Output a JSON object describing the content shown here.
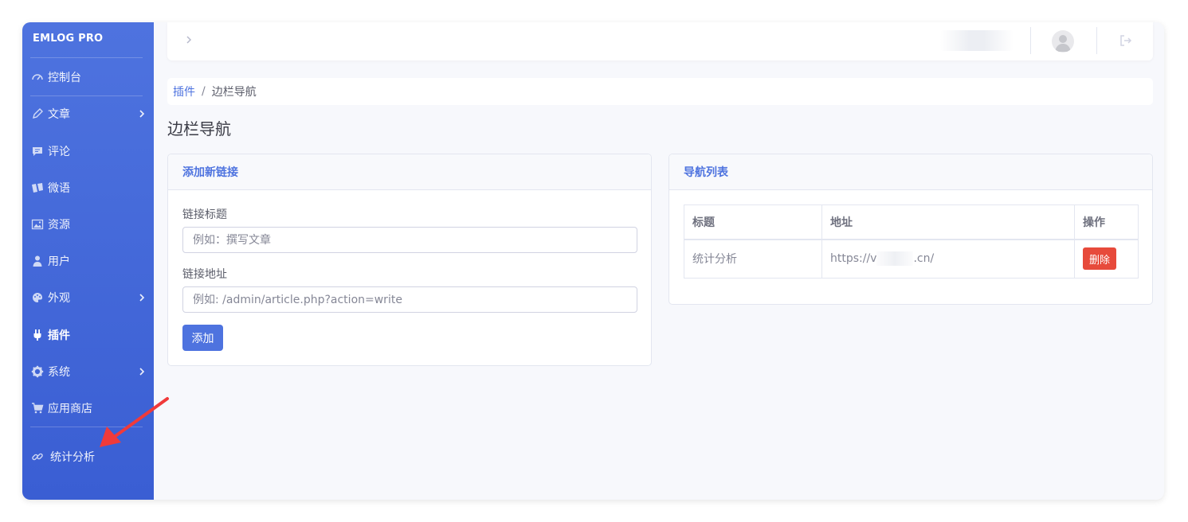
{
  "sidebar": {
    "brand": "EMLOG PRO",
    "items": [
      {
        "label": "控制台",
        "icon": "dashboard-icon"
      },
      {
        "label": "文章",
        "icon": "pencil-icon",
        "has_submenu": true
      },
      {
        "label": "评论",
        "icon": "comment-icon"
      },
      {
        "label": "微语",
        "icon": "tags-icon"
      },
      {
        "label": "资源",
        "icon": "image-icon"
      },
      {
        "label": "用户",
        "icon": "user-icon"
      },
      {
        "label": "外观",
        "icon": "palette-icon",
        "has_submenu": true
      },
      {
        "label": "插件",
        "icon": "plug-icon",
        "active": true
      },
      {
        "label": "系统",
        "icon": "gear-icon",
        "has_submenu": true
      },
      {
        "label": "应用商店",
        "icon": "cart-icon"
      },
      {
        "label": "统计分析",
        "icon": "link-icon"
      }
    ]
  },
  "colors": {
    "sidebar": "#4e73df",
    "primary": "#4e73df",
    "danger": "#e74a3b",
    "annotation_arrow": "#f03a3a"
  },
  "breadcrumb": {
    "parent": "插件",
    "current": "边栏导航"
  },
  "page_title": "边栏导航",
  "add_link": {
    "title": "添加新链接",
    "name_label": "链接标题",
    "name_placeholder": "例如：撰写文章",
    "url_label": "链接地址",
    "url_placeholder": "例如: /admin/article.php?action=write",
    "submit_label": "添加"
  },
  "nav_list": {
    "title": "导航列表",
    "columns": [
      "标题",
      "地址",
      "操作"
    ],
    "rows": [
      {
        "title": "统计分析",
        "url_prefix": "https://v",
        "url_suffix": ".cn/",
        "action": "删除"
      }
    ]
  }
}
